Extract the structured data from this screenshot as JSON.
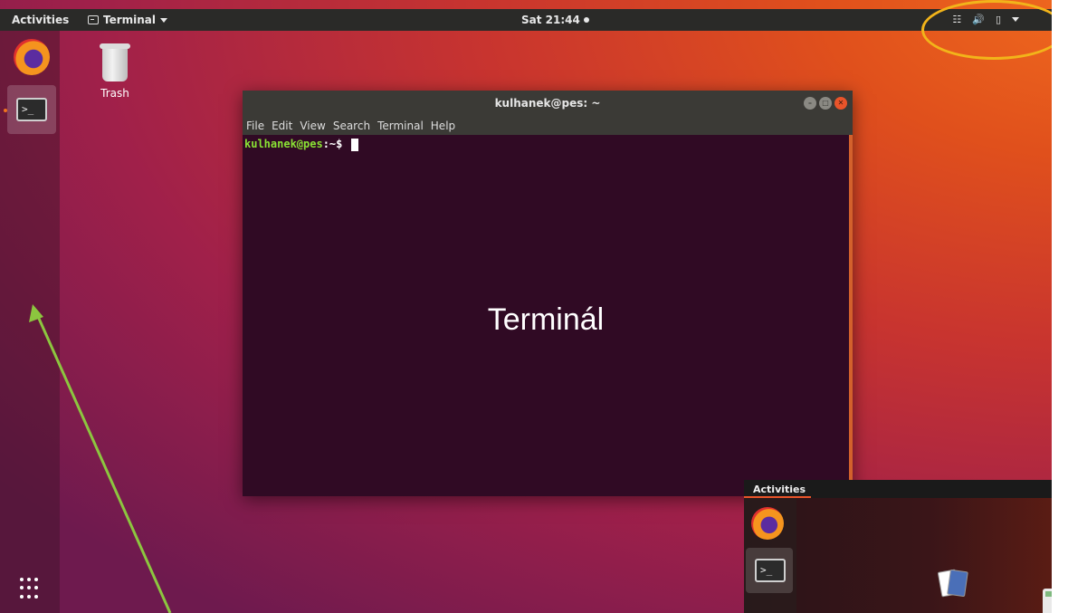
{
  "topbar": {
    "activities": "Activities",
    "app_menu": "Terminal",
    "clock": "Sat 21:44"
  },
  "desktop": {
    "trash_label": "Trash"
  },
  "terminal": {
    "title": "kulhanek@pes: ~",
    "menu": [
      "File",
      "Edit",
      "View",
      "Search",
      "Terminal",
      "Help"
    ],
    "prompt_user": "kulhanek@pes",
    "prompt_path": ":~$ ",
    "overlay": "Terminál"
  },
  "inset": {
    "activities": "Activities"
  },
  "icons": {
    "tray": [
      "network-icon",
      "volume-icon",
      "battery-icon",
      "chevron-down-icon"
    ]
  },
  "colors": {
    "highlight_ellipse": "#f2b41a",
    "annotation_arrow": "#8cc63f",
    "prompt_user": "#8ae234",
    "terminal_bg": "#300a24"
  }
}
